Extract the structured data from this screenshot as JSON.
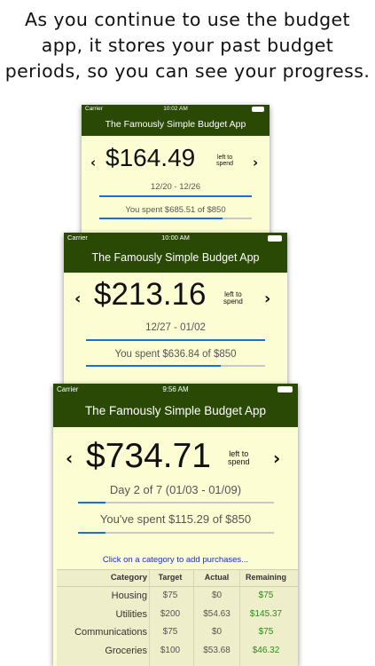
{
  "caption": {
    "line1": "As you continue to use the budget",
    "line2": "app, it stores your past budget",
    "line3": "periods, so you can see your progress."
  },
  "colors": {
    "header_green": "#2a4905",
    "screen_bg": "#fdfdd3",
    "progress_blue": "#1a6ee0",
    "remaining_green": "#2e8a1a",
    "link_blue": "#1530c8"
  },
  "screens": [
    {
      "carrier": "Carrier",
      "time": "10:02 AM",
      "app_title": "The Famously Simple Budget App",
      "prev_arrow": "‹",
      "next_arrow": "›",
      "amount": "$164.49",
      "left_to_line1": "left to",
      "left_to_line2": "spend",
      "period": "12/20 - 12/26",
      "period_progress": 1.0,
      "spent_text": "You spent $685.51 of $850",
      "spent_progress": 0.81
    },
    {
      "carrier": "Carrier",
      "time": "10:00 AM",
      "app_title": "The Famously Simple Budget App",
      "prev_arrow": "‹",
      "next_arrow": "›",
      "amount": "$213.16",
      "left_to_line1": "left to",
      "left_to_line2": "spend",
      "period": "12/27 - 01/02",
      "period_progress": 1.0,
      "spent_text": "You spent $636.84 of $850",
      "spent_progress": 0.75
    },
    {
      "carrier": "Carrier",
      "time": "9:56 AM",
      "app_title": "The Famously Simple Budget App",
      "prev_arrow": "‹",
      "next_arrow": "›",
      "amount": "$734.71",
      "left_to_line1": "left to",
      "left_to_line2": "spend",
      "period": "Day 2 of 7 (01/03 - 01/09)",
      "period_progress": 0.14,
      "spent_text": "You've spent $115.29 of $850",
      "spent_progress": 0.14,
      "hint": "Click on a category to add purchases...",
      "table": {
        "headers": {
          "category": "Category",
          "target": "Target",
          "actual": "Actual",
          "remaining": "Remaining"
        },
        "rows": [
          {
            "category": "Housing",
            "target": "$75",
            "actual": "$0",
            "remaining": "$75"
          },
          {
            "category": "Utilities",
            "target": "$200",
            "actual": "$54.63",
            "remaining": "$145.37"
          },
          {
            "category": "Communications",
            "target": "$75",
            "actual": "$0",
            "remaining": "$75"
          },
          {
            "category": "Groceries",
            "target": "$100",
            "actual": "$53.68",
            "remaining": "$46.32"
          }
        ]
      }
    }
  ]
}
